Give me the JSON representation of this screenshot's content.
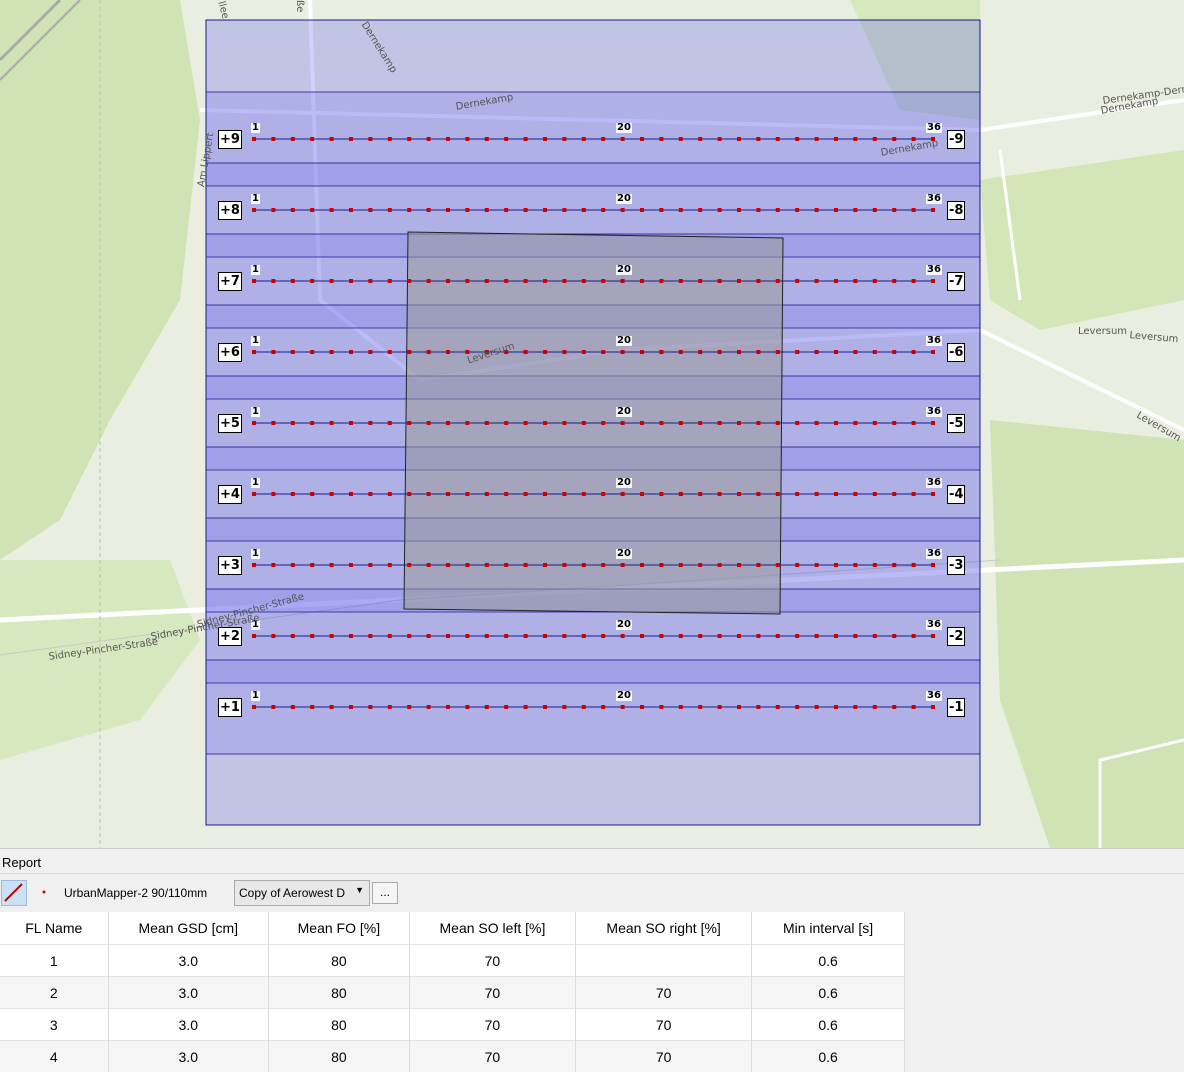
{
  "map": {
    "street_labels": [
      "Dernekamp",
      "Dernekamp",
      "Dernekamp",
      "Dernekamp",
      "Dernekamp-Derne",
      "Leversum",
      "Leversum",
      "Leversum",
      "Leversum",
      "Am Lippert",
      "Sidney-Pincher-Straße",
      "Sidney-Pincher-Straße",
      "Sidney-Pincher-Straße",
      "ße",
      "llee"
    ],
    "flight_lines": [
      {
        "start": "+9",
        "end": "-9"
      },
      {
        "start": "+8",
        "end": "-8"
      },
      {
        "start": "+7",
        "end": "-7"
      },
      {
        "start": "+6",
        "end": "-6"
      },
      {
        "start": "+5",
        "end": "-5"
      },
      {
        "start": "+4",
        "end": "-4"
      },
      {
        "start": "+3",
        "end": "-3"
      },
      {
        "start": "+2",
        "end": "-2"
      },
      {
        "start": "+1",
        "end": "-1"
      }
    ],
    "photo_numbers": {
      "first": "1",
      "middle": "20",
      "last": "36"
    },
    "photo_count": 36,
    "colors": {
      "strip": "#5a5af0",
      "line": "#1a1a8c",
      "photo": "#cc0000",
      "aoi": "#9a9a9a"
    }
  },
  "report": {
    "title": "Report",
    "camera": "UrbanMapper-2 90/110mm",
    "profile": "Copy of Aerowest D",
    "more_button": "...",
    "columns": [
      "FL Name",
      "Mean GSD [cm]",
      "Mean FO [%]",
      "Mean SO left [%]",
      "Mean SO right [%]",
      "Min interval [s]"
    ],
    "rows": [
      [
        "1",
        "3.0",
        "80",
        "70",
        "",
        "0.6"
      ],
      [
        "2",
        "3.0",
        "80",
        "70",
        "70",
        "0.6"
      ],
      [
        "3",
        "3.0",
        "80",
        "70",
        "70",
        "0.6"
      ],
      [
        "4",
        "3.0",
        "80",
        "70",
        "70",
        "0.6"
      ]
    ]
  }
}
